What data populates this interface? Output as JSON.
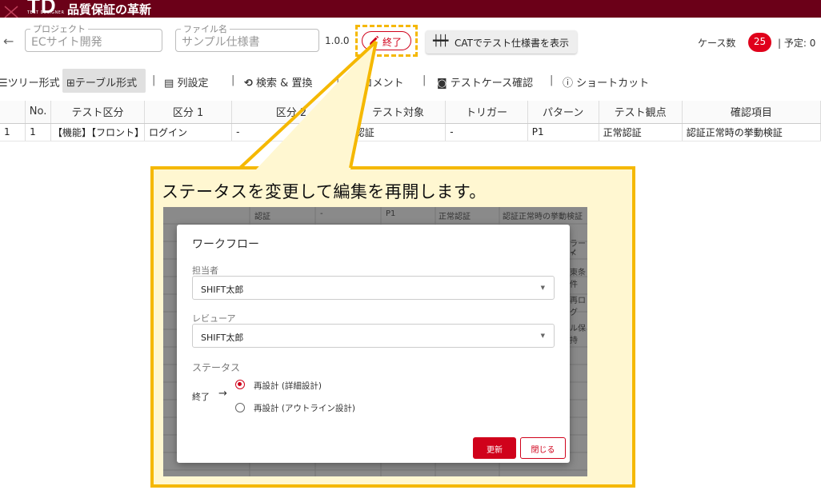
{
  "app": {
    "logo": "TD",
    "logo_sub": "TEST DESIGNER",
    "title": "品質保証の革新"
  },
  "header": {
    "back_icon": "arrow-left-icon",
    "project_legend": "プロジェクト",
    "project_value": "ECサイト開発",
    "file_legend": "ファイル名",
    "file_value": "サンプル仕様書",
    "version": "1.0.0",
    "end_button": "終了",
    "cat_button": "CATでテスト仕様書を表示",
    "cases_label": "ケース数",
    "cases_count": "25",
    "plan_label": "| 予定: 0"
  },
  "toolbar": {
    "tree": "ツリー形式",
    "table": "テーブル形式",
    "columns": "列設定",
    "search": "検索 & 置換",
    "comment": "コメント",
    "testcase": "テストケース確認",
    "shortcut": "ショートカット"
  },
  "table": {
    "headers": [
      "No.",
      "テスト区分",
      "区分 1",
      "区分 2",
      "テスト対象",
      "トリガー",
      "パターン",
      "テスト観点",
      "確認項目"
    ],
    "rows": [
      {
        "index": "1",
        "cells": [
          "1",
          "【機能】【フロント】",
          "ログイン",
          "-",
          "認証",
          "-",
          "P1",
          "正常認証",
          "認証正常時の挙動検証"
        ]
      }
    ]
  },
  "callout": {
    "text": "ステータスを変更して編集を再開します。"
  },
  "background_grid": {
    "row": [
      "認証",
      "-",
      "P1",
      "正常認証",
      "認証正常時の挙動検証"
    ],
    "right_fragments": [
      "ラー⊀",
      "東条件",
      "再ログ",
      "ル保持"
    ]
  },
  "dialog": {
    "title": "ワークフロー",
    "assignee_label": "担当者",
    "assignee_value": "SHIFT太郎",
    "reviewer_label": "レビューア",
    "reviewer_value": "SHIFT太郎",
    "status_label": "ステータス",
    "end_label": "終了",
    "option_1": "再設計 (詳細設計)",
    "option_2": "再設計 (アウトライン設計)",
    "selected": "再設計 (詳細設計)",
    "update_button": "更新",
    "close_button": "閉じる"
  },
  "colors": {
    "brand": "#6b0018",
    "accent": "#d0021b",
    "highlight": "#f5b800",
    "callout_bg": "#fff7d1"
  }
}
